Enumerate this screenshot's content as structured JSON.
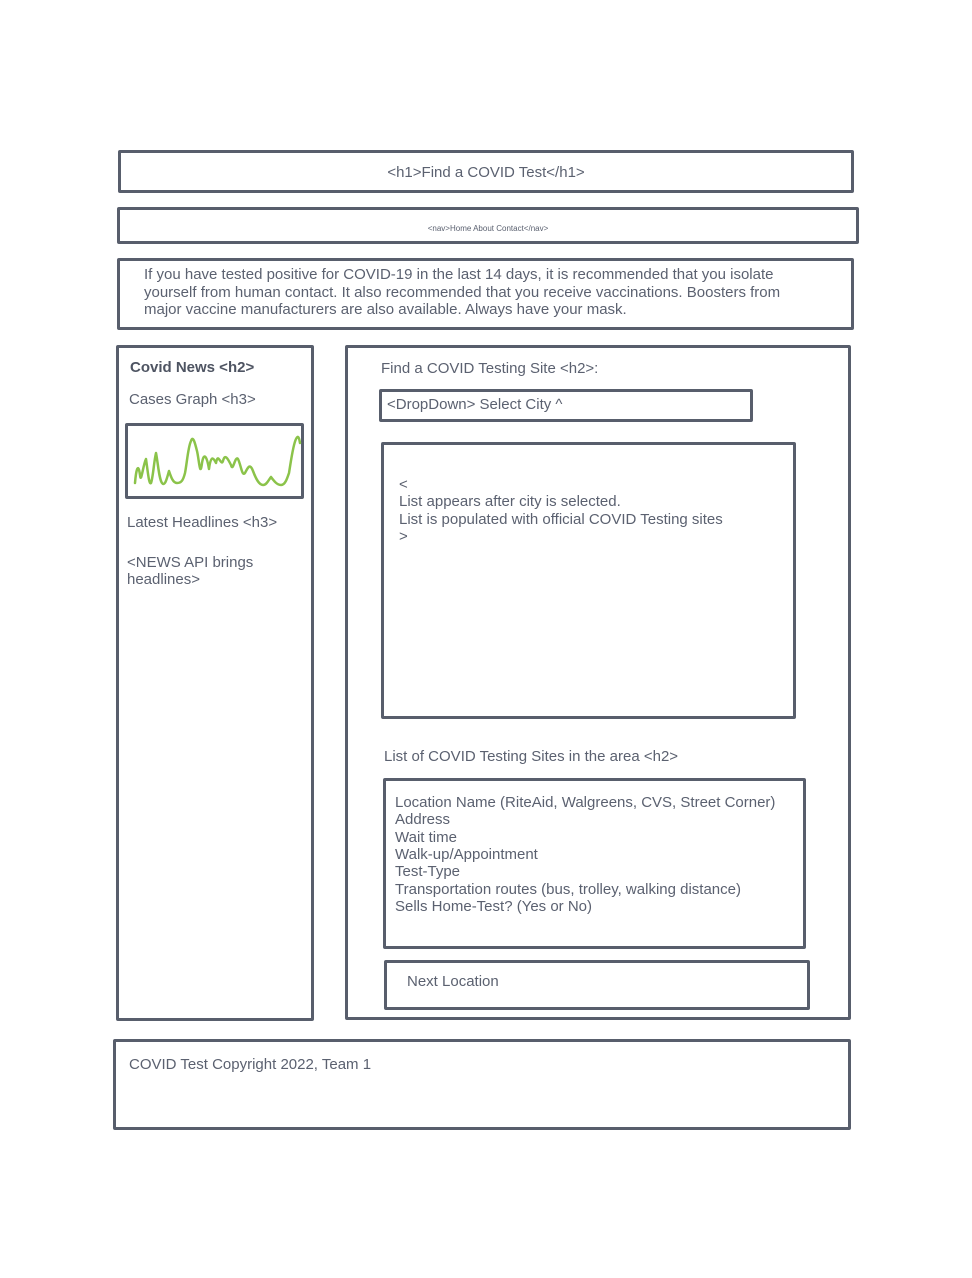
{
  "header": {
    "title": "<h1>Find a COVID Test</h1>"
  },
  "nav": {
    "text": "<nav>Home About Contact</nav>"
  },
  "intro": {
    "lines": [
      "If you have tested positive for COVID-19 in the last 14 days, it is recommended that you isolate",
      "yourself from human contact. It also recommended that you receive vaccinations. Boosters from",
      "major vaccine manufacturers are also available. Always have your mask."
    ]
  },
  "sidebar": {
    "heading": "Covid News <h2>",
    "graph_heading": "Cases Graph <h3>",
    "headlines_heading": "Latest Headlines <h3>",
    "news_api_line1": "<NEWS API brings",
    "news_api_line2": "headlines>"
  },
  "main": {
    "find_heading": "Find a COVID Testing Site <h2>:",
    "dropdown_label": "<DropDown> Select City ^",
    "results_lines": [
      "<",
      "List appears after city is selected.",
      "List is populated with official COVID Testing sites",
      ">"
    ],
    "list_heading": "List of COVID Testing Sites in the area <h2>",
    "site_fields": [
      "Location Name (RiteAid, Walgreens, CVS, Street Corner)",
      "Address",
      "Wait time",
      "Walk-up/Appointment",
      "Test-Type",
      "Transportation routes (bus, trolley, walking distance)",
      "Sells Home-Test? (Yes or No)"
    ],
    "next_button_label": "Next Location"
  },
  "footer": {
    "text": "COVID Test Copyright 2022, Team 1"
  },
  "colors": {
    "outline": "#585e6c",
    "text": "#5b6170",
    "graph_stroke": "#8bc34a"
  },
  "icons": {
    "graph_sketch": "sparkline-icon"
  }
}
